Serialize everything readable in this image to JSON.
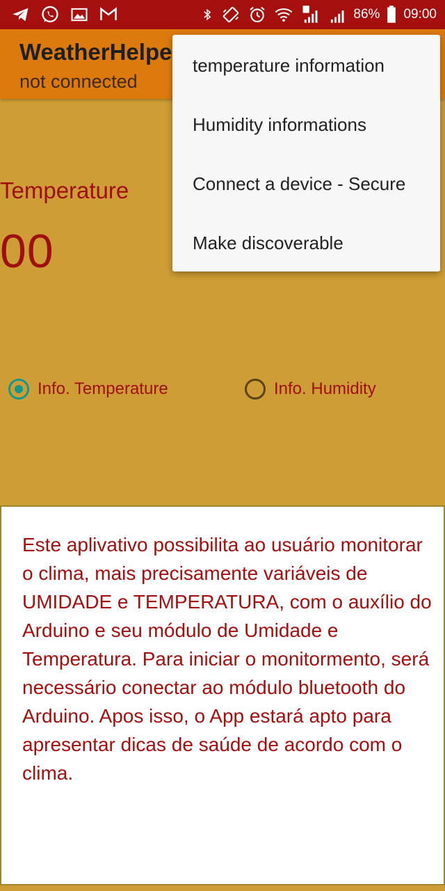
{
  "status_bar": {
    "left_icons": [
      "telegram-icon",
      "whatsapp-icon",
      "gallery-icon",
      "gmail-icon"
    ],
    "right_icons": [
      "bluetooth-icon",
      "vibrate-icon",
      "alarm-icon",
      "wifi-icon",
      "signal-sim1-icon",
      "signal-sim2-icon",
      "battery-icon"
    ],
    "battery": "86%",
    "time": "09:00"
  },
  "app_bar": {
    "title": "WeatherHelpe",
    "subtitle": "not connected",
    "color": "#DD7A0E"
  },
  "main": {
    "temperature_label": "Temperature",
    "temperature_value": "00",
    "radio_options": [
      {
        "label": "Info. Temperature",
        "selected": true
      },
      {
        "label": "Info. Humidity",
        "selected": false
      }
    ],
    "info_text": "Este aplivativo possibilita ao usuário monitorar o clima, mais precisamente variáveis de UMIDADE e TEMPERATURA, com o auxílio do Arduino e seu módulo de Umidade e Temperatura. Para iniciar o monitormento, será necessário conectar ao módulo bluetooth do Arduino. Apos isso, o App estará apto para apresentar dicas de saúde de acordo com o clima."
  },
  "overflow_menu": {
    "items": [
      {
        "label": "temperature information"
      },
      {
        "label": "Humidity informations"
      },
      {
        "label": "Connect a device - Secure"
      },
      {
        "label": "Make discoverable"
      }
    ]
  },
  "colors": {
    "status_bar": "#A50F0D",
    "background": "#CF9D35",
    "accent_text": "#9F0F0F",
    "radio_accent": "#17978A"
  }
}
